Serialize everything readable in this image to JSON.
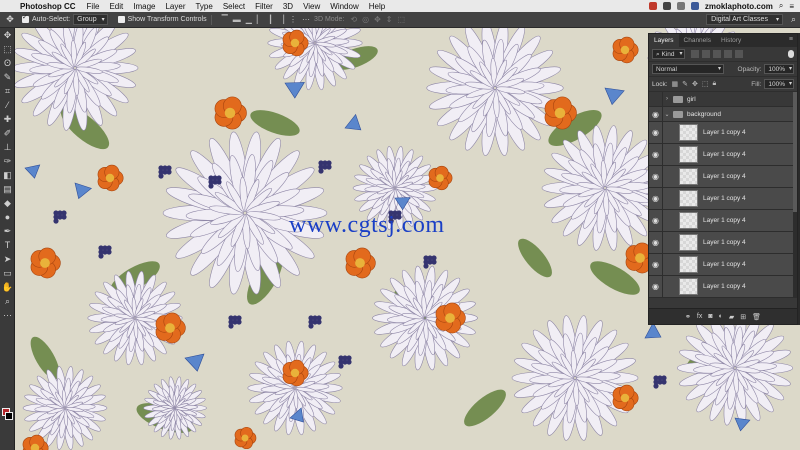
{
  "menubar": {
    "app": "Photoshop CC",
    "items": [
      "File",
      "Edit",
      "Image",
      "Layer",
      "Type",
      "Select",
      "Filter",
      "3D",
      "View",
      "Window",
      "Help"
    ],
    "host": "zmoklaphoto.com"
  },
  "options": {
    "auto_select_label": "Auto-Select:",
    "auto_select_value": "Group",
    "show_transform_label": "Show Transform Controls",
    "mode_label": "3D Mode:",
    "workspace": "Digital Art Classes"
  },
  "watermark": "www.cgtsj.com",
  "panel": {
    "tabs": [
      "Layers",
      "Channels",
      "History"
    ],
    "filter": "Kind",
    "blend_mode": "Normal",
    "opacity_label": "Opacity:",
    "opacity": "100%",
    "lock_label": "Lock:",
    "fill_label": "Fill:",
    "fill": "100%",
    "groups": [
      "girl",
      "background"
    ],
    "layers": [
      "Layer 1 copy 4",
      "Layer 1 copy 4",
      "Layer 1 copy 4",
      "Layer 1 copy 4",
      "Layer 1 copy 4",
      "Layer 1 copy 4",
      "Layer 1 copy 4",
      "Layer 1 copy 4"
    ]
  },
  "colors": {
    "canvas_bg": "#dcd9c9",
    "chrysanthemum": "#f1eef5",
    "poppy": "#e26a1d",
    "bluebell": "#5a86cc",
    "berry": "#35346f",
    "leaf": "#6f8a4c",
    "foreground": "#b3262b",
    "background": "#000000"
  }
}
